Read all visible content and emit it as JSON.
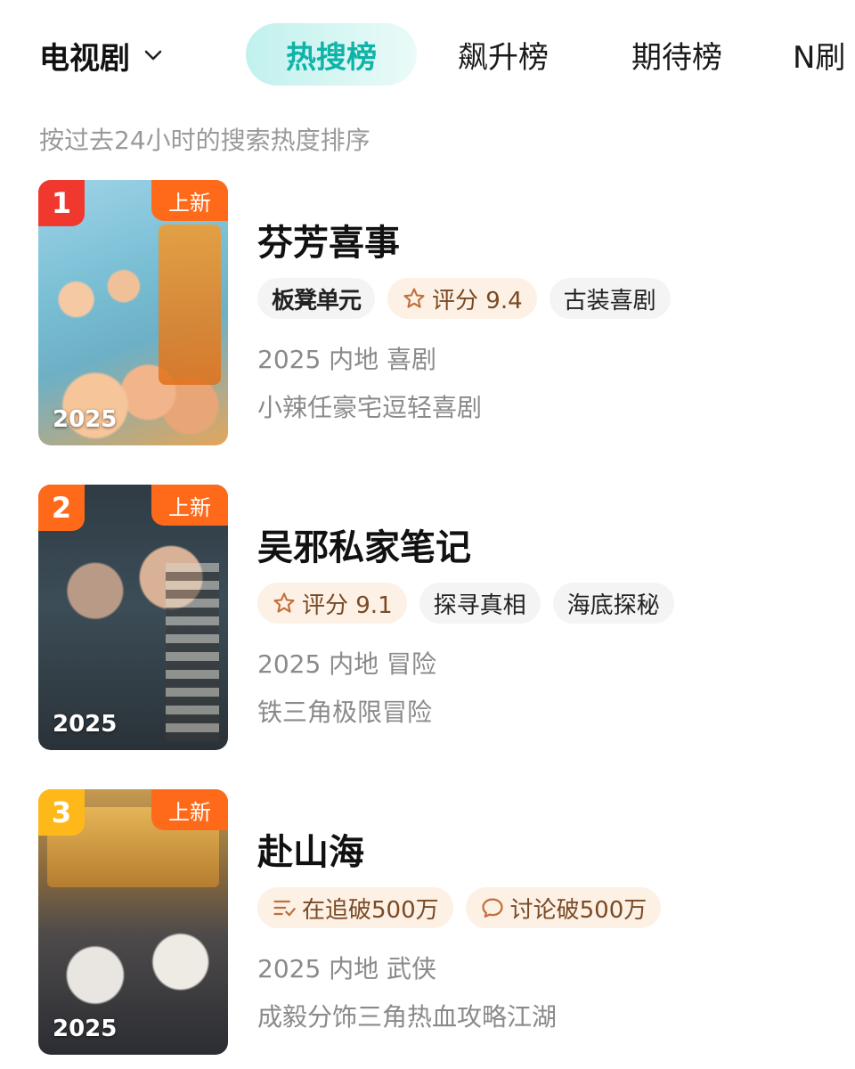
{
  "header": {
    "category_label": "电视剧",
    "tabs": [
      {
        "label": "热搜榜",
        "active": true
      },
      {
        "label": "飙升榜"
      },
      {
        "label": "期待榜"
      },
      {
        "label": "N刷"
      }
    ]
  },
  "subtitle": "按过去24小时的搜索热度排序",
  "items": [
    {
      "rank": "1",
      "new_label": "上新",
      "year": "2025",
      "title": "芬芳喜事",
      "tags": [
        {
          "text": "板凳单元",
          "icon": "brand-logo"
        },
        {
          "text": "评分 9.4",
          "icon": "star-icon"
        },
        {
          "text": "古装喜剧"
        }
      ],
      "meta": "2025 内地 喜剧",
      "desc": "小辣任豪宅逗轻喜剧",
      "rank_color": "#f0382e"
    },
    {
      "rank": "2",
      "new_label": "上新",
      "year": "2025",
      "title": "吴邪私家笔记",
      "tags": [
        {
          "text": "评分 9.1",
          "icon": "star-icon"
        },
        {
          "text": "探寻真相"
        },
        {
          "text": "海底探秘"
        }
      ],
      "meta": "2025 内地 冒险",
      "desc": "铁三角极限冒险",
      "rank_color": "#ff6a1a"
    },
    {
      "rank": "3",
      "new_label": "上新",
      "year": "2025",
      "title": "赴山海",
      "tags": [
        {
          "text": "在追破500万",
          "icon": "list-icon"
        },
        {
          "text": "讨论破500万",
          "icon": "chat-icon"
        }
      ],
      "meta": "2025 内地 武侠",
      "desc": "成毅分饰三角热血攻略江湖",
      "rank_color": "#ffb81a"
    }
  ],
  "colors": {
    "accent": "#10b3a8",
    "new_tag": "#ff6a1a",
    "warm_tag_bg": "#fdf0e4"
  }
}
